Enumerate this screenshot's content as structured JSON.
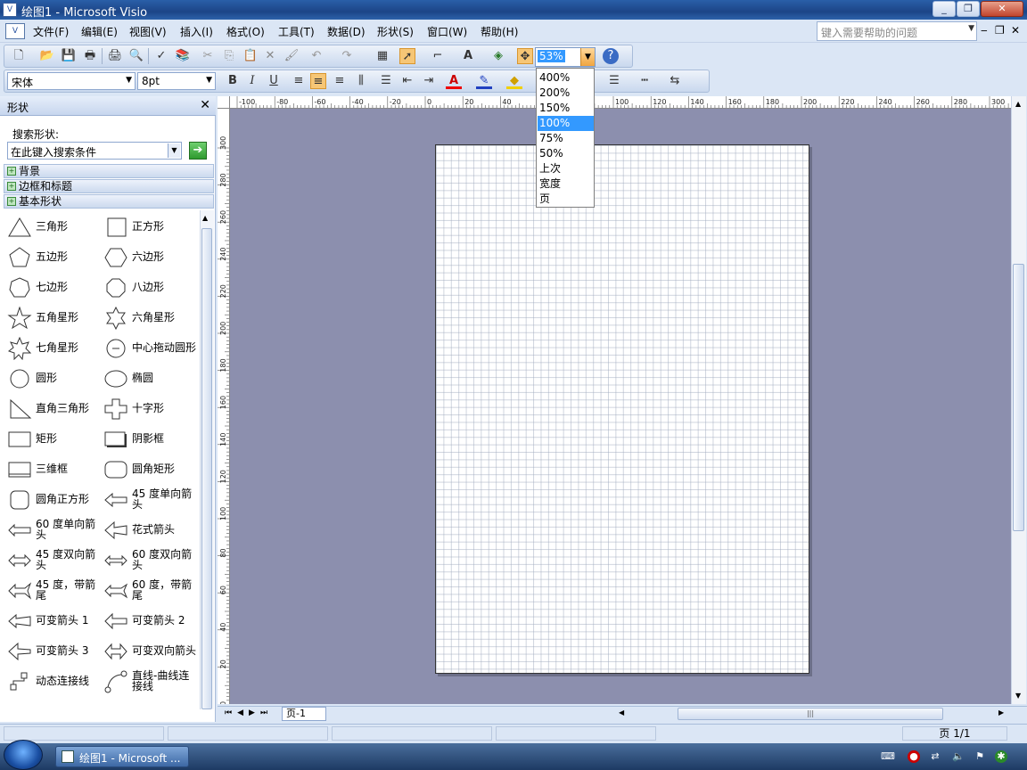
{
  "window": {
    "title": "绘图1 - Microsoft Visio",
    "app_icon": "visio-icon",
    "minimize": "_",
    "restore": "❐",
    "close": "✕"
  },
  "menu": [
    "文件(F)",
    "编辑(E)",
    "视图(V)",
    "插入(I)",
    "格式(O)",
    "工具(T)",
    "数据(D)",
    "形状(S)",
    "窗口(W)",
    "帮助(H)"
  ],
  "help": {
    "placeholder": "键入需要帮助的问题"
  },
  "zoom": {
    "value": "53%",
    "options": [
      "400%",
      "200%",
      "150%",
      "100%",
      "75%",
      "50%",
      "上次",
      "宽度",
      "页"
    ],
    "selected": "100%"
  },
  "format": {
    "font": "宋体",
    "size": "8pt"
  },
  "shapes_panel": {
    "title": "形状",
    "search_label": "搜索形状:",
    "search_placeholder": "在此键入搜索条件",
    "stencils": [
      "背景",
      "边框和标题",
      "基本形状"
    ],
    "shapes": [
      "三角形",
      "正方形",
      "五边形",
      "六边形",
      "七边形",
      "八边形",
      "五角星形",
      "六角星形",
      "七角星形",
      "中心拖动圆形",
      "圆形",
      "椭圆",
      "直角三角形",
      "十字形",
      "矩形",
      "阴影框",
      "三维框",
      "圆角矩形",
      "圆角正方形",
      "45 度单向箭头",
      "60 度单向箭头",
      "花式箭头",
      "45 度双向箭头",
      "60 度双向箭头",
      "45 度，带箭尾",
      "60 度，带箭尾",
      "可变箭头 1",
      "可变箭头 2",
      "可变箭头 3",
      "可变双向箭头",
      "动态连接线",
      "直线-曲线连接线"
    ]
  },
  "hruler": [
    "-100",
    "-80",
    "-60",
    "-40",
    "-20",
    "0",
    "20",
    "40",
    "60",
    "80",
    "100",
    "120",
    "140",
    "160",
    "180",
    "200",
    "220",
    "240",
    "260",
    "280",
    "300"
  ],
  "vruler": [
    "300",
    "280",
    "260",
    "240",
    "220",
    "200",
    "180",
    "160",
    "140",
    "120",
    "100",
    "80",
    "60",
    "40",
    "20",
    "0"
  ],
  "page_tab": "页-1",
  "status": {
    "page_count": "页 1/1"
  },
  "taskbar": {
    "item": "绘图1 - Microsoft ..."
  }
}
